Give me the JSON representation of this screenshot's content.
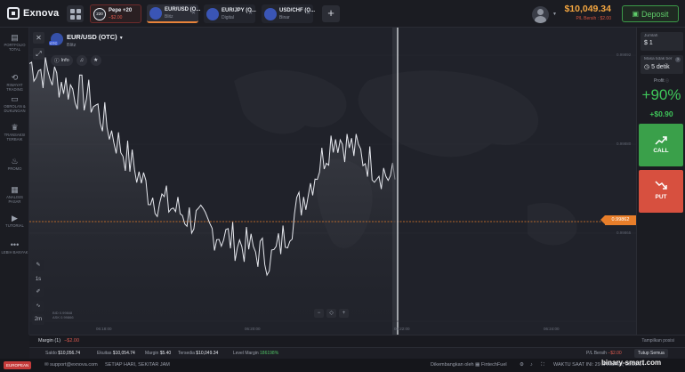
{
  "app": {
    "name": "Exnova"
  },
  "tabs": [
    {
      "name": "Pepe +20",
      "sub": "−$2.00",
      "badge": "220"
    },
    {
      "name": "EUR/USD (O...",
      "sub": "Blitz"
    },
    {
      "name": "EUR/JPY (O...",
      "sub": "Digital"
    },
    {
      "name": "USD/CHF (O...",
      "sub": "Binar"
    }
  ],
  "header": {
    "balance": "$10,049.34",
    "pl_label": "P/L Bersih : $2.00",
    "deposit_label": "Deposit"
  },
  "sidebar": {
    "items": [
      {
        "label": "PORTFOLIO TOTAL",
        "icon": "briefcase-icon"
      },
      {
        "label": "RIWAYAT TRADING",
        "icon": "history-icon"
      },
      {
        "label": "OBROLAN & DUKUNGAN",
        "icon": "chat-icon"
      },
      {
        "label": "TRANSAKSI TERBAIK",
        "icon": "trophy-icon"
      },
      {
        "label": "PROMO",
        "icon": "fire-icon"
      },
      {
        "label": "ANALISIS PASAR",
        "icon": "news-icon"
      },
      {
        "label": "TUTORIAL",
        "icon": "tutorial-icon"
      },
      {
        "label": "LEBIH BANYAK",
        "icon": "more-icon"
      }
    ]
  },
  "chart": {
    "asset_title": "EUR/USD (OTC)",
    "asset_sub": "Blitz",
    "otc_badge": "OTC",
    "info_label": "Info",
    "current_price": "0.99865",
    "price_tag": "0.99862",
    "y_labels": [
      "0.99892",
      "0.99880",
      "0.99865"
    ],
    "x_labels": [
      "06:18:00",
      "06:20:00",
      "06:22:00",
      "06:24:00"
    ],
    "bid": "BID 0.99848",
    "ask": "ASK 0.99866",
    "timeframes": [
      "1s",
      "2m"
    ],
    "zoom": [
      "−",
      "◇",
      "+"
    ]
  },
  "chart_data": {
    "type": "area",
    "title": "EUR/USD (OTC)",
    "xlabel": "",
    "ylabel": "",
    "x": [
      "06:18:00",
      "06:20:00",
      "06:22:00"
    ],
    "series": [
      {
        "name": "EUR/USD (OTC)",
        "values": [
          0.99895,
          0.99885,
          0.99858,
          0.99848,
          0.9984,
          0.99875,
          0.99862
        ]
      }
    ],
    "ylim": [
      0.9983,
      0.999
    ]
  },
  "order": {
    "amount_label": "Jumlah",
    "amount_value": "$ 1",
    "expiry_label": "Masa tidak ber",
    "expiry_value": "5 detik",
    "profit_label": "Profit",
    "profit_pct": "+90%",
    "profit_amount": "+$0.90",
    "call_label": "CALL",
    "put_label": "PUT"
  },
  "margin": {
    "title": "Margin (1)",
    "pl": "−$2.00",
    "show_positions": "Tampilkan posisi"
  },
  "stats": {
    "saldo_label": "Saldo",
    "saldo": "$10,056.74",
    "ekuitas_label": "Ekuitas",
    "ekuitas": "$10,054.74",
    "margin_label": "Margin",
    "margin": "$5.40",
    "tersedia_label": "Tersedia",
    "tersedia": "$10,049.34",
    "level_label": "Level Margin",
    "level": "186198%",
    "pl_label": "P/L Bersih",
    "pl": "−$2.00",
    "close_all": "Tutup Semua"
  },
  "footer": {
    "lang": "EUROPEAN",
    "email": "support@exnova.com",
    "hours": "SETIAP HARI, SEKITAR JAM",
    "developer": "Dikembangkan oleh ▦ FintechFuel",
    "time": "WAKTU SAAT INI: 29 JANUARI, 06:23:14",
    "watermark": "binary-smart.com"
  },
  "colors": {
    "accent_orange": "#e87e2a",
    "call_green": "#3aa04a",
    "put_red": "#d7503f",
    "balance_orange": "#f2a540"
  }
}
